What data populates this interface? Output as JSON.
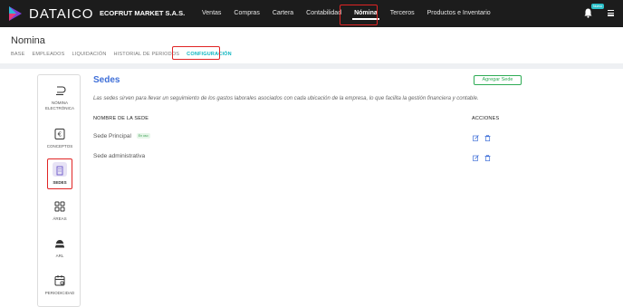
{
  "topbar": {
    "brand": "DATAICO",
    "company": "ECOFRUT MARKET S.A.S.",
    "nav": [
      "Ventas",
      "Compras",
      "Cartera",
      "Contabilidad",
      "Nómina",
      "Terceros",
      "Productos e Inventario"
    ],
    "active_nav": "Nómina",
    "notification_badge": "Nuevo"
  },
  "header": {
    "title": "Nomina",
    "tabs": [
      "BASE",
      "EMPLEADOS",
      "LIQUIDACIÓN",
      "HISTORIAL DE PERIODOS",
      "CONFIGURACIÓN"
    ],
    "active_tab": "CONFIGURACIÓN"
  },
  "sidebar": {
    "items": [
      {
        "label_line1": "NÓMINA",
        "label_line2": "ELECTRÓNICA",
        "icon": "toggle-icon"
      },
      {
        "label_line1": "CONCEPTOS",
        "label_line2": "",
        "icon": "concept-icon"
      },
      {
        "label_line1": "SEDES",
        "label_line2": "",
        "icon": "building-icon"
      },
      {
        "label_line1": "ÁREAS",
        "label_line2": "",
        "icon": "grid-icon"
      },
      {
        "label_line1": "ARL",
        "label_line2": "",
        "icon": "helmet-icon"
      },
      {
        "label_line1": "PERIODICIDAD",
        "label_line2": "",
        "icon": "calendar-icon"
      }
    ],
    "active": "SEDES"
  },
  "main": {
    "title": "Sedes",
    "add_button": "Agregar Sede",
    "description": "Las sedes sirven para llevar un seguimiento de los gastos laborales asociados con cada ubicación de la empresa, lo que facilita la gestión financiera y contable.",
    "columns": [
      "NOMBRE DE LA SEDE",
      "ACCIONES"
    ],
    "rows": [
      {
        "name": "Sede Principal",
        "badge": "En uso"
      },
      {
        "name": "Sede administrativa",
        "badge": ""
      }
    ]
  },
  "colors": {
    "topbar": "#1c1c1c",
    "accent": "#0bb5c0",
    "title_blue": "#3f6fd8",
    "green": "#2eac55",
    "highlight": "#e02424"
  }
}
